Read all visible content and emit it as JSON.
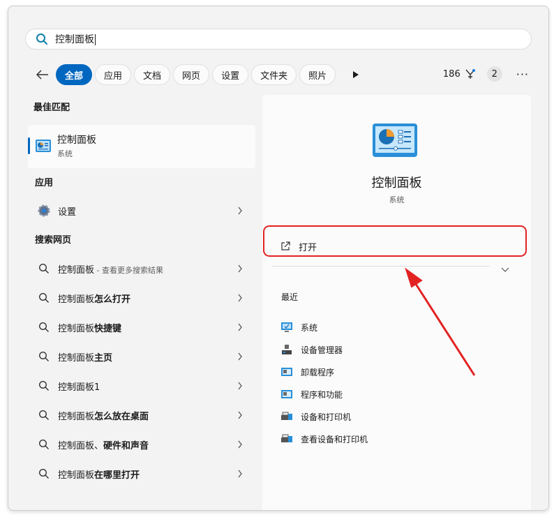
{
  "search": {
    "query": "控制面板"
  },
  "filters": {
    "chips": [
      "全部",
      "应用",
      "文档",
      "网页",
      "设置",
      "文件夹",
      "照片"
    ],
    "points": "186",
    "count_badge": "2",
    "more": "···"
  },
  "left": {
    "best_match_title": "最佳匹配",
    "best_match": {
      "title": "控制面板",
      "subtitle": "系统"
    },
    "apps_title": "应用",
    "apps": [
      {
        "label": "设置"
      }
    ],
    "web_title": "搜索网页",
    "web_items": [
      {
        "normal": "控制面板",
        "bold": "",
        "hint": " - 查看更多搜索结果"
      },
      {
        "normal": "控制面板",
        "bold": "怎么打开",
        "hint": ""
      },
      {
        "normal": "控制面板",
        "bold": "快捷键",
        "hint": ""
      },
      {
        "normal": "控制面板",
        "bold": "主页",
        "hint": ""
      },
      {
        "normal": "控制面板1",
        "bold": "",
        "hint": ""
      },
      {
        "normal": "控制面板",
        "bold": "怎么放在桌面",
        "hint": ""
      },
      {
        "normal": "控制面板、",
        "bold": "硬件和声音",
        "hint": ""
      },
      {
        "normal": "控制面板",
        "bold": "在哪里打开",
        "hint": ""
      }
    ]
  },
  "detail": {
    "title": "控制面板",
    "subtitle": "系统",
    "open_label": "打开",
    "recent_title": "最近",
    "recent": [
      "系统",
      "设备管理器",
      "卸载程序",
      "程序和功能",
      "设备和打印机",
      "查看设备和打印机"
    ]
  },
  "colors": {
    "accent": "#0067c0",
    "annotation": "#e32222"
  }
}
